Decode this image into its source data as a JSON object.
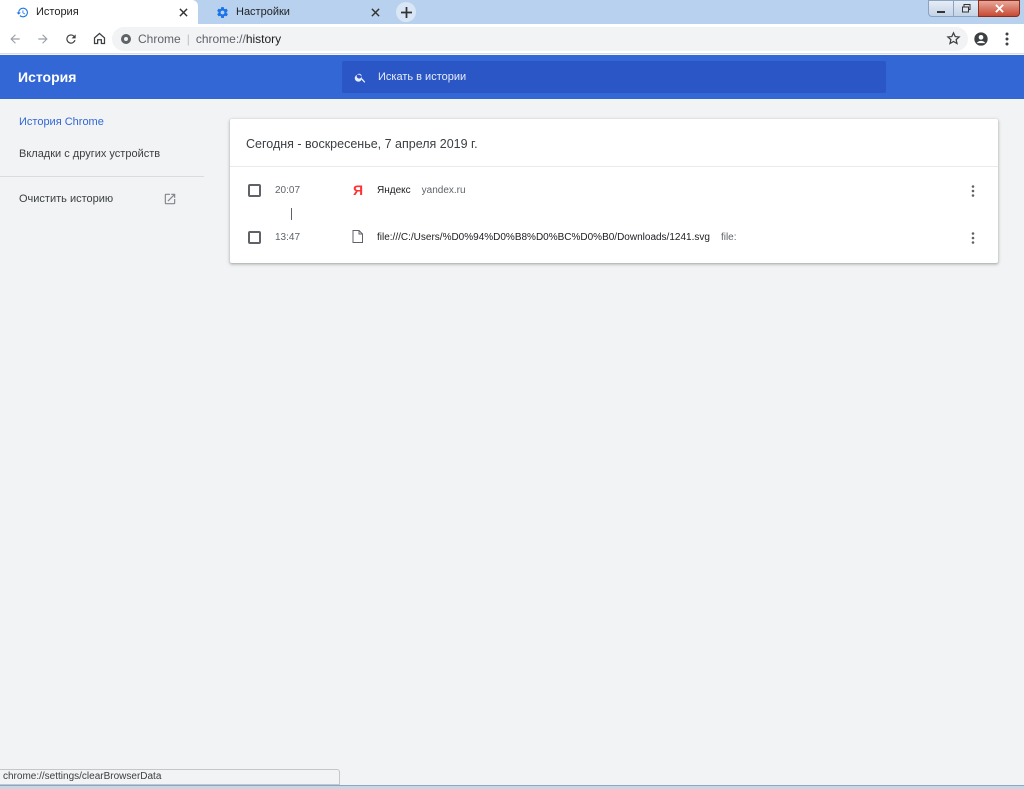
{
  "tabs": [
    {
      "title": "История",
      "icon": "history-icon",
      "active": true
    },
    {
      "title": "Настройки",
      "icon": "settings-gear-icon",
      "active": false
    }
  ],
  "omnibox": {
    "scheme_label": "Chrome",
    "url_prefix": "chrome://",
    "url_host": "history"
  },
  "header": {
    "title": "История",
    "search_placeholder": "Искать в истории"
  },
  "sidebar": {
    "items": [
      {
        "label": "История Chrome",
        "selected": true
      },
      {
        "label": "Вкладки с других устройств",
        "selected": false
      }
    ],
    "clear_label": "Очистить историю"
  },
  "history": {
    "date_heading": "Сегодня - воскресенье, 7 апреля 2019 г.",
    "entries": [
      {
        "time": "20:07",
        "title": "Яндекс",
        "domain": "yandex.ru",
        "favicon": "yandex-icon"
      },
      {
        "time": "13:47",
        "title": "file:///C:/Users/%D0%94%D0%B8%D0%BC%D0%B0/Downloads/1241.svg",
        "domain": "file:",
        "favicon": "file-icon"
      }
    ]
  },
  "status_bar": {
    "text": "chrome://settings/clearBrowserData"
  },
  "colors": {
    "header_blue": "#3367d6",
    "search_blue": "#2a56c6",
    "page_background": "#f1f3f4",
    "tabstrip": "#b7d1ee"
  }
}
